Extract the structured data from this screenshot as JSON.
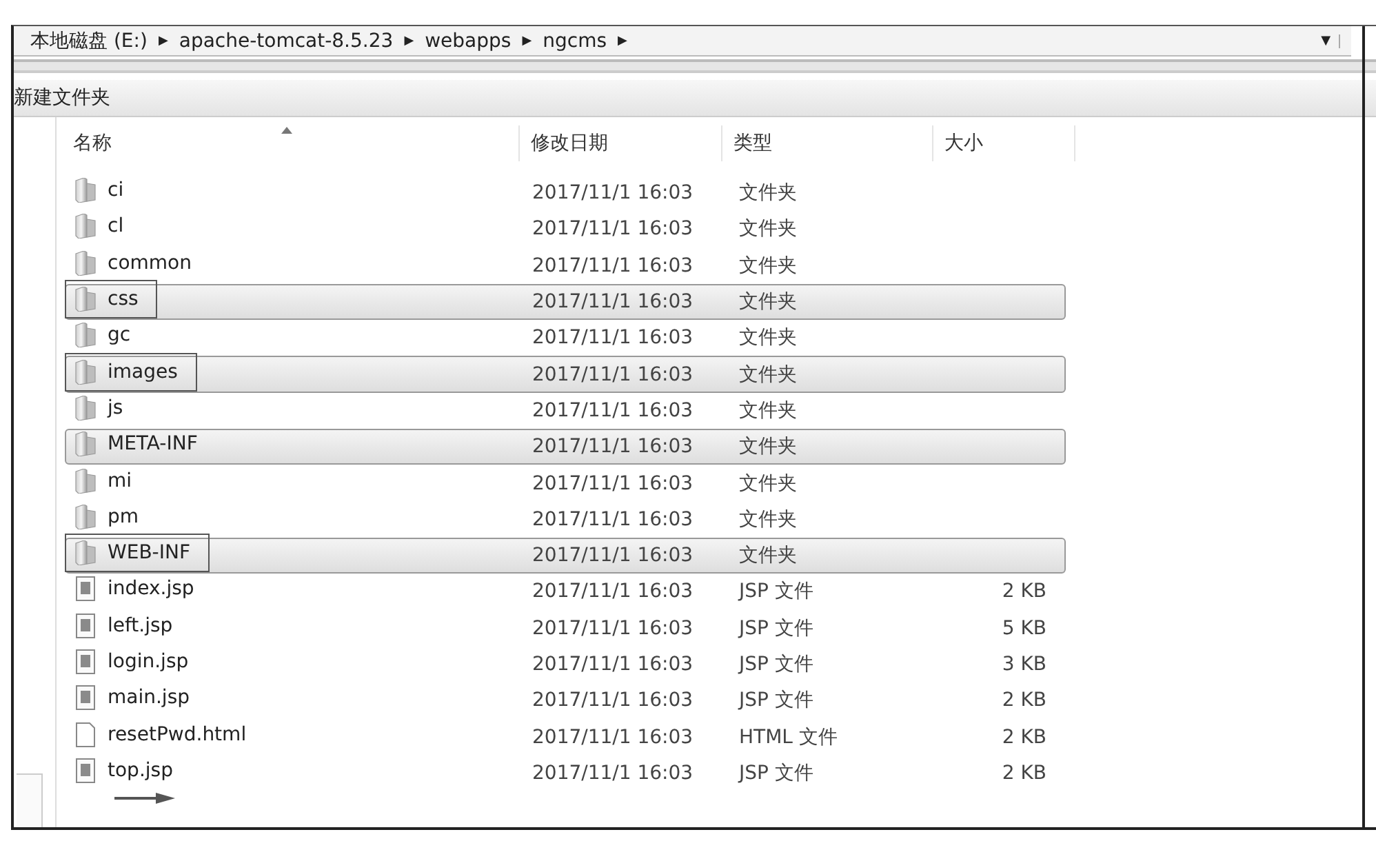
{
  "address_bar": {
    "crumbs": [
      "本地磁盘 (E:)",
      "apache-tomcat-8.5.23",
      "webapps",
      "ngcms"
    ],
    "separator": "▶",
    "dropdown": "▼"
  },
  "toolbar": {
    "buttons": [
      "新建文件夹"
    ]
  },
  "columns": [
    {
      "label": "名称",
      "sorted": true
    },
    {
      "label": "修改日期",
      "sorted": false
    },
    {
      "label": "类型",
      "sorted": false
    },
    {
      "label": "大小",
      "sorted": false
    }
  ],
  "rows": [
    {
      "kind": "folder",
      "name": "ci",
      "date": "2017/11/1 16:03",
      "type": "文件夹",
      "selected": false,
      "boxed": false
    },
    {
      "kind": "folder",
      "name": "cl",
      "date": "2017/11/1 16:03",
      "type": "文件夹",
      "selected": false,
      "boxed": false
    },
    {
      "kind": "folder",
      "name": "common",
      "date": "2017/11/1 16:03",
      "type": "文件夹",
      "selected": false,
      "boxed": false
    },
    {
      "kind": "folder",
      "name": "css",
      "date": "2017/11/1 16:03",
      "type": "文件夹",
      "selected": true,
      "boxed": true
    },
    {
      "kind": "folder",
      "name": "gc",
      "date": "2017/11/1 16:03",
      "type": "文件夹",
      "selected": false,
      "boxed": false
    },
    {
      "kind": "folder",
      "name": "images",
      "date": "2017/11/1 16:03",
      "type": "文件夹",
      "selected": true,
      "boxed": true
    },
    {
      "kind": "folder",
      "name": "js",
      "date": "2017/11/1 16:03",
      "type": "文件夹",
      "selected": false,
      "boxed": false
    },
    {
      "kind": "folder",
      "name": "META-INF",
      "date": "2017/11/1 16:03",
      "type": "文件夹",
      "selected": true,
      "boxed": false
    },
    {
      "kind": "folder",
      "name": "mi",
      "date": "2017/11/1 16:03",
      "type": "文件夹",
      "selected": false,
      "boxed": false
    },
    {
      "kind": "folder",
      "name": "pm",
      "date": "2017/11/1 16:03",
      "type": "文件夹",
      "selected": false,
      "boxed": false
    },
    {
      "kind": "folder",
      "name": "WEB-INF",
      "date": "2017/11/1 16:03",
      "type": "文件夹",
      "selected": true,
      "boxed": true
    },
    {
      "kind": "script",
      "name": "index.jsp",
      "date": "2017/11/1 16:03",
      "type": "JSP 文件",
      "size": "2 KB",
      "selected": false,
      "boxed": false
    },
    {
      "kind": "script",
      "name": "left.jsp",
      "date": "2017/11/1 16:03",
      "type": "JSP 文件",
      "size": "5 KB",
      "selected": false,
      "boxed": false
    },
    {
      "kind": "script",
      "name": "login.jsp",
      "date": "2017/11/1 16:03",
      "type": "JSP 文件",
      "size": "3 KB",
      "selected": false,
      "boxed": false
    },
    {
      "kind": "script",
      "name": "main.jsp",
      "date": "2017/11/1 16:03",
      "type": "JSP 文件",
      "size": "2 KB",
      "selected": false,
      "boxed": false
    },
    {
      "kind": "page",
      "name": "resetPwd.html",
      "date": "2017/11/1 16:03",
      "type": "HTML 文件",
      "size": "2 KB",
      "selected": false,
      "boxed": false
    },
    {
      "kind": "script",
      "name": "top.jsp",
      "date": "2017/11/1 16:03",
      "type": "JSP 文件",
      "size": "2 KB",
      "selected": false,
      "boxed": false,
      "arrow": true
    }
  ]
}
